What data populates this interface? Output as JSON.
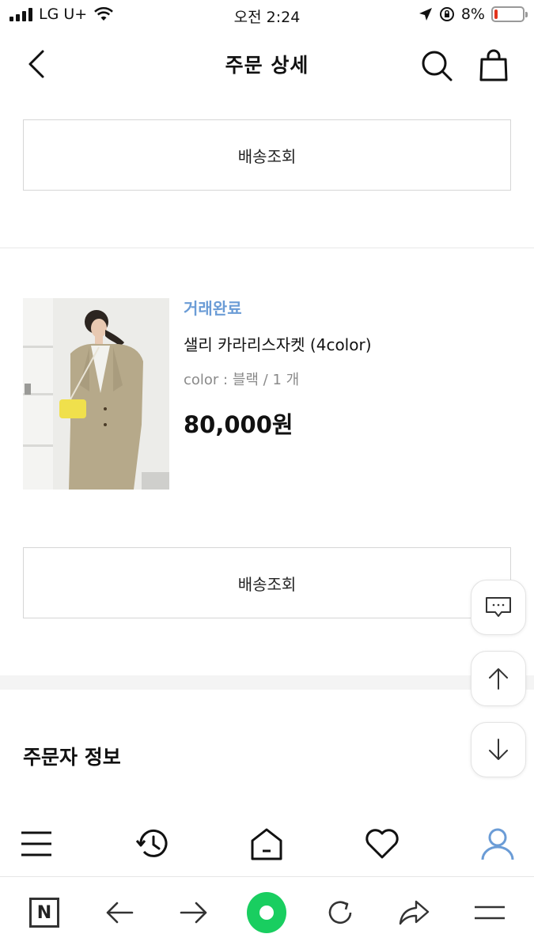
{
  "status_bar": {
    "carrier": "LG U+",
    "time": "오전 2:24",
    "battery_percent_label": "8%",
    "battery_level": 0.08,
    "battery_color": "#e2341d"
  },
  "header": {
    "title": "주문 상세",
    "back_icon": "chevron-left-icon",
    "search_icon": "search-icon",
    "cart_icon": "shopping-bag-icon"
  },
  "top_action": {
    "label": "배송조회"
  },
  "product": {
    "status": "거래완료",
    "status_color": "#6b9cd6",
    "name": "샐리 카라리스자켓 (4color)",
    "option": "color : 블랙 / 1 개",
    "price": "80,000원"
  },
  "product_action": {
    "label": "배송조회"
  },
  "orderer_section": {
    "title": "주문자 정보"
  },
  "floating": [
    "chat-icon",
    "arrow-up-icon",
    "arrow-down-icon"
  ],
  "bottom_nav": [
    "menu-icon",
    "history-icon",
    "home-icon",
    "heart-icon",
    "user-icon"
  ],
  "bottom_nav_active_color": "#6b9cd6",
  "browser_bar": [
    "naver-icon",
    "back-arrow-icon",
    "forward-arrow-icon",
    "green-circle-icon",
    "reload-icon",
    "share-icon",
    "browser-menu-icon"
  ],
  "browser_naver_letter": "N"
}
